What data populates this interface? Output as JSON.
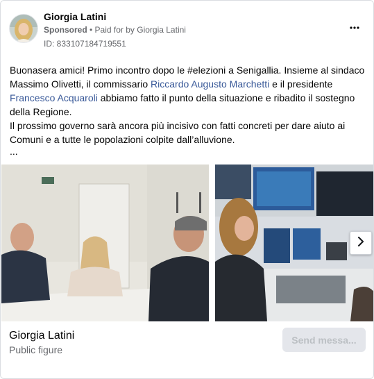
{
  "header": {
    "page_name": "Giorgia Latini",
    "sponsored": "Sponsored",
    "separator": " • ",
    "paid_for": "Paid for by Giorgia Latini",
    "ad_id": "ID: 833107184719551",
    "more_icon": "more-horizontal-icon"
  },
  "post": {
    "line1": "Buonasera amici! Primo incontro dopo le #elezioni a Senigallia. Insieme al sindaco Massimo Olivetti, il commissario ",
    "link1": "Riccardo Augusto Marchetti",
    "line2": " e il presidente ",
    "link2": "Francesco Acquaroli",
    "line3": " abbiamo fatto il punto della situazione e ribadito il sostegno della Regione.",
    "para2": "Il prossimo governo sarà ancora più incisivo con fatti concreti per dare aiuto ai Comuni e a tutte le popolazioni colpite dall’alluvione.",
    "ellipsis": "...",
    "link_color": "#385898"
  },
  "carousel": {
    "slides": [
      {
        "description": "meeting-photo"
      },
      {
        "description": "control-room-photo"
      }
    ],
    "next_icon": "chevron-right-icon"
  },
  "footer": {
    "name": "Giorgia Latini",
    "category": "Public figure",
    "send_button": "Send messa..."
  }
}
